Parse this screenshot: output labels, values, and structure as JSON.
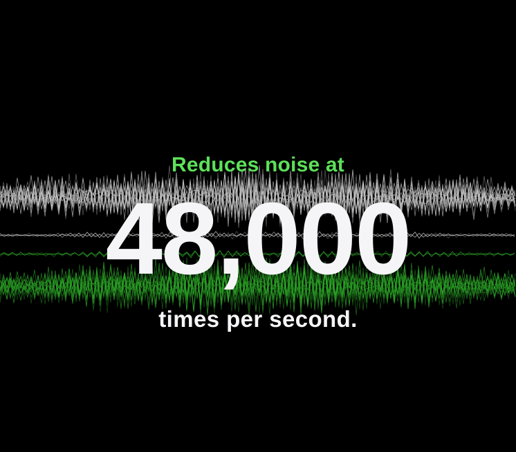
{
  "hero": {
    "eyebrow": "Reduces noise at",
    "figure": "48,000",
    "subline": "times per second."
  },
  "colors": {
    "background": "#000000",
    "eyebrow_text": "#5ee05a",
    "figure_text": "#f5f5f7",
    "subline_text": "#f5f5f7",
    "wave_noise": "#cfcfcf",
    "wave_clean": "#2fae2a"
  },
  "graphic": {
    "name": "noise-waveform-visualization"
  }
}
